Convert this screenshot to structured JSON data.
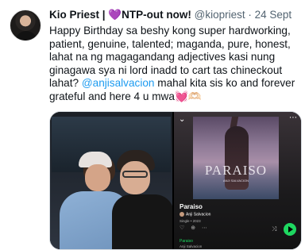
{
  "tweet": {
    "author_name": "Kio Priest | ",
    "heart_emoji": "💜",
    "name_suffix": "NTP-out now!",
    "handle": "@kiopriest",
    "separator": "·",
    "date": "24 Sept",
    "text_part1": "Happy Birthday sa beshy kong super hardworking, patient, genuine, talented; maganda, pure, honest, lahat na ng magagandang adjectives kasi nung ginagawa sya ni lord inadd to cart tas chineckout lahat? ",
    "mention": "@anjisalvacion",
    "text_part2": " mahal kita sis ko and forever grateful and here 4 u mwa",
    "end_heart": "💓",
    "end_emoji": "🫶🏻"
  },
  "spotify": {
    "back_icon": "chevron-down-icon",
    "menu_icon": "more-icon",
    "album_logo": "ⓐ",
    "album_title": "PARAISO",
    "album_subtitle": "ANJI SALVACION",
    "song_title": "Paraiso",
    "artist": "Anji Salvacion",
    "meta": "Single • 2023",
    "action_icons": "♡ ⊕ ⋯",
    "shuffle_icon": "⤨",
    "track_title": "Paraiso",
    "track_artist": "Anji Salvacion",
    "accent_color": "#1ed760"
  },
  "colors": {
    "link": "#1d9bf0",
    "muted": "#536471"
  }
}
